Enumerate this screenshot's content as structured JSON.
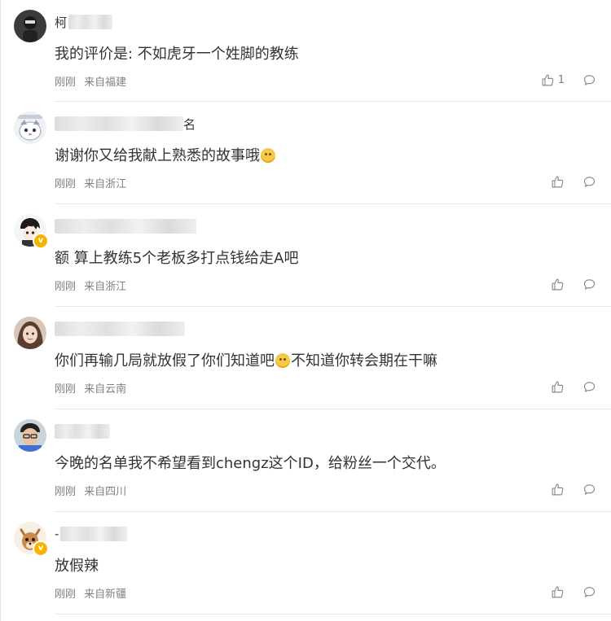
{
  "comments": [
    {
      "name_visible": "柯",
      "name_suffix": "",
      "text": "我的评价是: 不如虎牙一个姓脚的教练",
      "time": "刚刚",
      "location": "来自福建",
      "likes": "1",
      "verified": false,
      "emoji": ""
    },
    {
      "name_visible": "",
      "name_suffix": "名",
      "text": "谢谢你又给我献上熟悉的故事哦",
      "time": "刚刚",
      "location": "来自浙江",
      "likes": "",
      "verified": false,
      "emoji": "laugh"
    },
    {
      "name_visible": "",
      "name_suffix": "",
      "text": "额 算上教练5个老板多打点钱给走A吧",
      "time": "刚刚",
      "location": "来自浙江",
      "likes": "",
      "verified": true,
      "emoji": ""
    },
    {
      "name_visible": "",
      "name_suffix": "",
      "text_a": "你们再输几局就放假了你们知道吧",
      "text_b": "不知道你转会期在干嘛",
      "time": "刚刚",
      "location": "来自云南",
      "likes": "",
      "verified": false,
      "emoji": "smile"
    },
    {
      "name_visible": "",
      "name_suffix": "",
      "text": "今晚的名单我不希望看到chengz这个ID，给粉丝一个交代。",
      "time": "刚刚",
      "location": "来自四川",
      "likes": "",
      "verified": false,
      "emoji": ""
    },
    {
      "name_visible": "-",
      "name_suffix": "",
      "text": "放假辣",
      "time": "刚刚",
      "location": "来自新疆",
      "likes": "",
      "verified": true,
      "emoji": ""
    }
  ],
  "icons": {
    "like": "thumbs-up-icon",
    "reply": "comment-bubble-icon",
    "verified_badge": "v"
  },
  "colors": {
    "text": "#333333",
    "meta": "#808080",
    "badge": "#f4b400",
    "divider": "#e9e9e9"
  }
}
